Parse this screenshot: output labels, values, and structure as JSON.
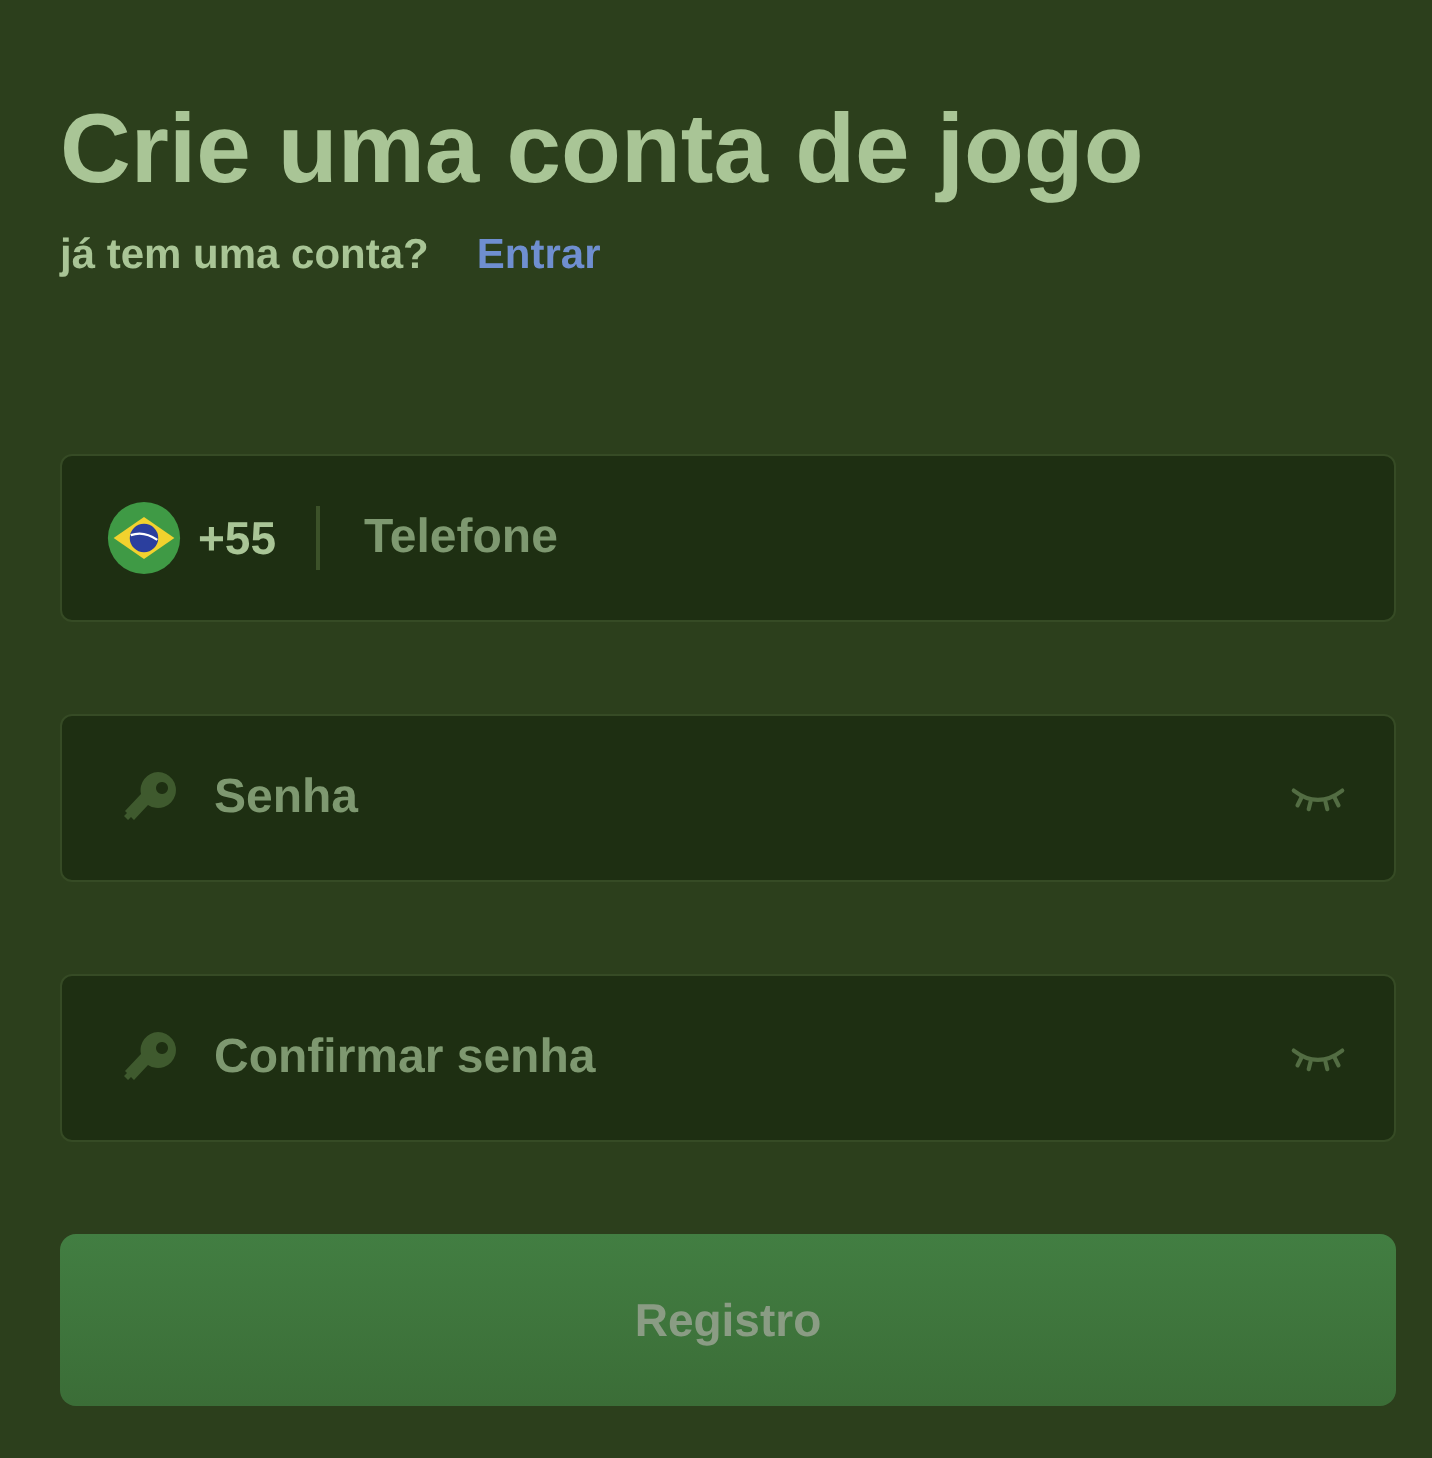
{
  "title": "Crie uma conta de jogo",
  "login_prompt": {
    "text": "já tem uma conta?",
    "link": "Entrar"
  },
  "fields": [
    {
      "kind": "phone",
      "code": "+55",
      "placeholder": "Telefone"
    },
    {
      "kind": "password",
      "placeholder": "Senha",
      "visible": false
    },
    {
      "kind": "password",
      "placeholder": "Confirmar senha",
      "visible": false
    }
  ],
  "submit": {
    "label": "Registro",
    "disabled": true
  }
}
